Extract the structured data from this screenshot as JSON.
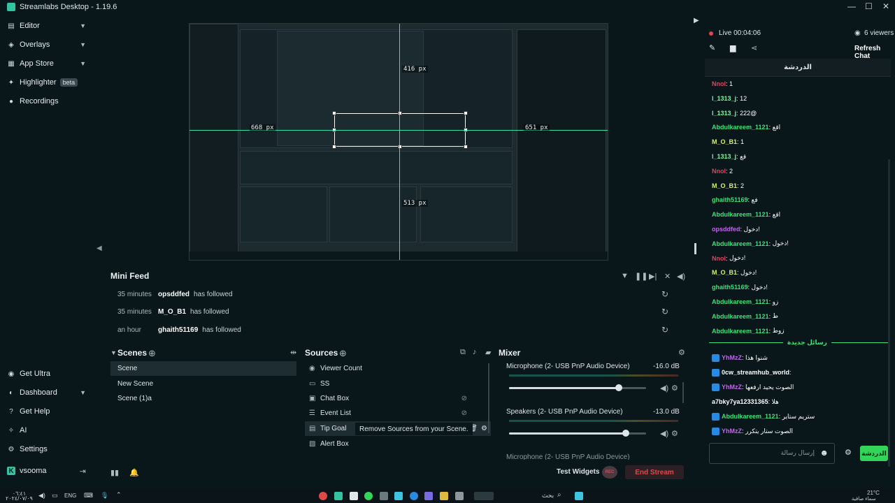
{
  "window": {
    "title": "Streamlabs Desktop - 1.19.6",
    "minimize": "—",
    "maximize": "☐",
    "close": "✕"
  },
  "sidebar": {
    "items": [
      {
        "label": "Editor"
      },
      {
        "label": "Overlays"
      },
      {
        "label": "App Store"
      },
      {
        "label": "Highlighter",
        "badge": "beta"
      },
      {
        "label": "Recordings"
      }
    ],
    "bottom_items": [
      {
        "label": "Get Ultra"
      },
      {
        "label": "Dashboard"
      },
      {
        "label": "Get Help"
      },
      {
        "label": "AI"
      },
      {
        "label": "Settings"
      }
    ],
    "user": "vsooma"
  },
  "preview": {
    "measure_top": "416 px",
    "measure_left": "668 px",
    "measure_right": "651 px",
    "measure_bottom": "513 px"
  },
  "mini_feed": {
    "title": "Mini Feed",
    "events": [
      {
        "time": "35 minutes",
        "user": "opsddfed",
        "action": "has followed"
      },
      {
        "time": "35 minutes",
        "user": "M_O_B1",
        "action": "has followed"
      },
      {
        "time": "an hour",
        "user": "ghaith51169",
        "action": "has followed"
      }
    ]
  },
  "scenes": {
    "title": "Scenes",
    "items": [
      "Scene",
      "New Scene",
      "Scene (1)a"
    ]
  },
  "sources": {
    "title": "Sources",
    "items": [
      "Viewer Count",
      "SS",
      "Chat Box",
      "Event List",
      "Tip Goal",
      "Alert Box"
    ],
    "tooltip": "Remove Sources from your Scene."
  },
  "mixer": {
    "title": "Mixer",
    "channels": [
      {
        "name": "Microphone (2- USB PnP Audio Device)",
        "db": "-16.0 dB",
        "level": 0.8
      },
      {
        "name": "Speakers (2- USB PnP Audio Device)",
        "db": "-13.0 dB",
        "level": 0.85
      }
    ],
    "cut_label": "Microphone (2- USB PnP Audio Device)"
  },
  "footer": {
    "test_widgets": "Test Widgets",
    "rec": "REC",
    "end_stream": "End Stream"
  },
  "chat": {
    "live": "Live 00:04:06",
    "viewers": "6 viewers",
    "refresh": "Refresh Chat",
    "title": "الدردشة",
    "new_messages": "رسائل جديدة",
    "input_placeholder": "إرسال رسالة",
    "send_label": "الدردشة",
    "messages": [
      {
        "user": "Nnol",
        "text": "1",
        "color": "#e0455a"
      },
      {
        "user": "l_1313_j",
        "text": "12",
        "color": "#7ef5a0"
      },
      {
        "user": "l_1313_j",
        "text": "222@",
        "color": "#7ef5a0"
      },
      {
        "user": "Abdulkareem_1121",
        "text": "اقع",
        "color": "#3ee07b"
      },
      {
        "user": "M_O_B1",
        "text": "1",
        "color": "#d8f06a"
      },
      {
        "user": "l_1313_j",
        "text": "قع",
        "color": "#7ef5a0"
      },
      {
        "user": "Nnol",
        "text": "2",
        "color": "#e0455a"
      },
      {
        "user": "M_O_B1",
        "text": "2",
        "color": "#d8f06a"
      },
      {
        "user": "ghaith51169",
        "text": "فع",
        "color": "#3ee07b"
      },
      {
        "user": "Abdulkareem_1121",
        "text": "اقع",
        "color": "#3ee07b"
      },
      {
        "user": "opsddfed",
        "text": "دخول!",
        "color": "#c068e8"
      },
      {
        "user": "Abdulkareem_1121",
        "text": "دخول!",
        "color": "#3ee07b"
      },
      {
        "user": "Nnol",
        "text": "دخول!",
        "color": "#e0455a"
      },
      {
        "user": "M_O_B1",
        "text": "دخول!",
        "color": "#d8f06a"
      },
      {
        "user": "ghaith51169",
        "text": "دخول!",
        "color": "#3ee07b"
      },
      {
        "user": "Abdulkareem_1121",
        "text": "زو",
        "color": "#3ee07b"
      },
      {
        "user": "Abdulkareem_1121",
        "text": "ط",
        "color": "#3ee07b"
      },
      {
        "user": "Abdulkareem_1121",
        "text": "زوط",
        "color": "#3ee07b"
      }
    ],
    "new": [
      {
        "user": "YhMzZ",
        "text": "شنوا هذا",
        "color": "#c068e8"
      },
      {
        "user": "0cw_streamhub_world",
        "text": "",
        "color": "#ffffff"
      },
      {
        "user": "YhMzZ",
        "text": "الصوت يحيد ارفعها",
        "color": "#c068e8"
      },
      {
        "user": "a7bky7ya12331365",
        "text": "هلا",
        "color": "#ffffff"
      },
      {
        "user": "Abdulkareem_1121",
        "text": "ستريم ستاير",
        "color": "#3ee07b"
      },
      {
        "user": "YhMzZ",
        "text": "الصوت ستار يتكرر",
        "color": "#c068e8"
      }
    ]
  },
  "taskbar": {
    "weather": "21°C",
    "weather_desc": "سماء صافية",
    "lang": "ENG",
    "date": "٢٠٢٤/٠٧/٠٩",
    "time": "٠٦:٤١",
    "search_placeholder": "بحث"
  },
  "colors": {
    "accent": "#31c3a2",
    "guide": "#3fe0a7",
    "end_stream": "#e04848"
  }
}
